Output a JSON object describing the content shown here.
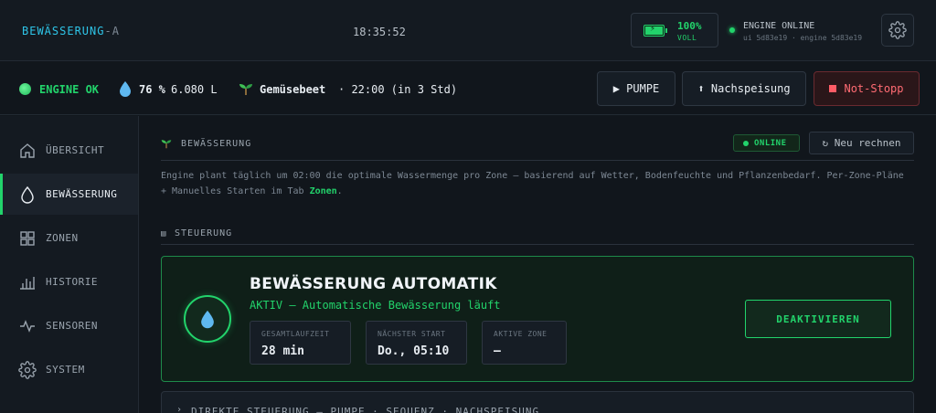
{
  "header": {
    "brand": "BEWÄSSERUNG",
    "brand_suffix": "-A",
    "clock": "18:35:52",
    "battery": {
      "percent": "100%",
      "state": "VOLL",
      "level": 1.0
    },
    "engine_status": "ENGINE ONLINE",
    "engine_versions": "ui 5d83e19 · engine 5d83e19"
  },
  "status": {
    "engine": "ENGINE OK",
    "water_percent": "76 %",
    "water_liters": "6.080 L",
    "plan_name": "Gemüsebeet",
    "plan_time": "· 22:00 (in 3 Std)"
  },
  "actions": {
    "pump": "▶ PUMPE",
    "refill": "⬆ Nachspeisung",
    "stop": "Not-Stopp"
  },
  "sidebar": {
    "items": [
      {
        "label": "ÜBERSICHT",
        "icon": "home-icon"
      },
      {
        "label": "BEWÄSSERUNG",
        "icon": "drop-icon"
      },
      {
        "label": "ZONEN",
        "icon": "grid-icon"
      },
      {
        "label": "HISTORIE",
        "icon": "bar-chart-icon"
      },
      {
        "label": "SENSOREN",
        "icon": "pulse-icon"
      },
      {
        "label": "SYSTEM",
        "icon": "gear-icon"
      }
    ],
    "active_index": 1
  },
  "main": {
    "section_title": "BEWÄSSERUNG",
    "online_badge": "ONLINE",
    "recalc_button": "↻ Neu rechnen",
    "description_part1": "Engine plant täglich um 02:00 die optimale Wassermenge pro Zone — basierend auf Wetter, Bodenfeuchte und Pflanzenbedarf. Per-Zone-Pläne + Manuelles Starten im Tab ",
    "description_link": "Zonen",
    "description_end": ".",
    "control_title": "STEUERUNG",
    "auto": {
      "title": "BEWÄSSERUNG AUTOMATIK",
      "subtitle": "AKTIV — Automatische Bewässerung läuft",
      "stats": [
        {
          "label": "GESAMTLAUFZEIT",
          "value": "28 min"
        },
        {
          "label": "NÄCHSTER START",
          "value": "Do., 05:10"
        },
        {
          "label": "AKTIVE ZONE",
          "value": "—"
        }
      ],
      "button": "DEAKTIVIEREN"
    },
    "direct_title": "DIREKTE STEUERUNG — PUMPE · SEQUENZ · NACHSPEISUNG"
  },
  "colors": {
    "accent_green": "#22d36b",
    "brand_cyan": "#2ec5e8",
    "danger_red": "#ff6b73",
    "background": "#11161c"
  }
}
